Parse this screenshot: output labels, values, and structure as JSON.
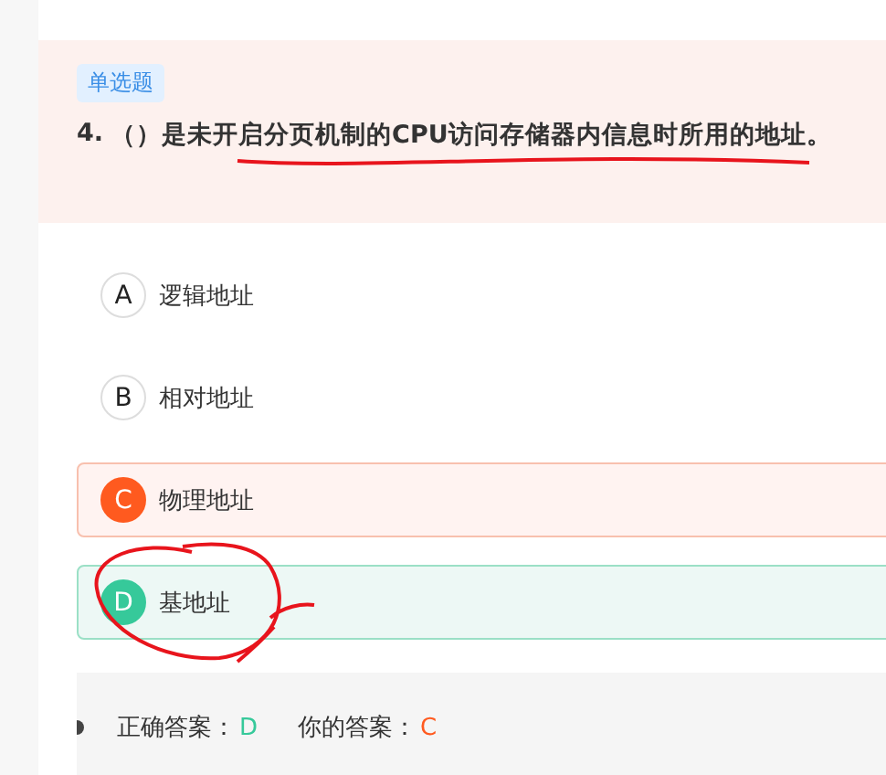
{
  "question": {
    "type_tag": "单选题",
    "number": "4.",
    "text": "（）是未开启分页机制的CPU访问存储器内信息时所用的地址。"
  },
  "options": [
    {
      "letter": "A",
      "text": "逻辑地址",
      "kind": "normal"
    },
    {
      "letter": "B",
      "text": "相对地址",
      "kind": "normal"
    },
    {
      "letter": "C",
      "text": "物理地址",
      "kind": "wrong"
    },
    {
      "letter": "D",
      "text": "基地址",
      "kind": "correct"
    }
  ],
  "answer": {
    "correct_label": "正确答案：",
    "correct": "D",
    "yours_label": "你的答案：",
    "yours": "C"
  }
}
